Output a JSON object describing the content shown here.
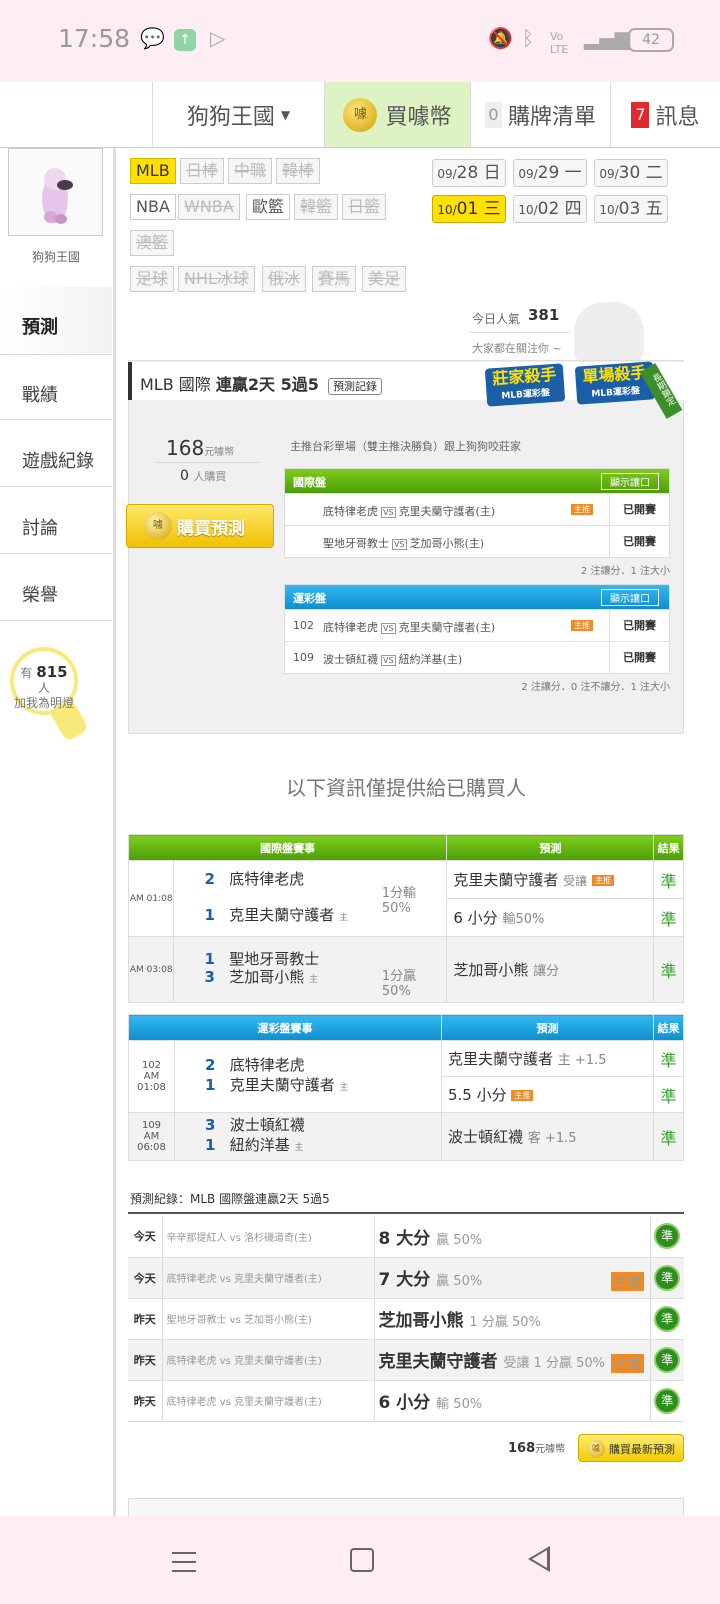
{
  "status": {
    "time": "17:58",
    "battery": "42"
  },
  "header": {
    "site": "狗狗王國",
    "buy_label": "買噱幣",
    "coin_glyph": "噱",
    "cart_count": "0",
    "cart_label": "購牌清單",
    "msg_count": "7",
    "msg_label": "訊息"
  },
  "sidebar": {
    "user_name": "狗狗王國",
    "items": [
      "預測",
      "戰績",
      "遊戲紀錄",
      "討論",
      "榮譽"
    ],
    "fans_prefix": "有",
    "fans_count": "815",
    "fans_unit": "人",
    "fans_sub": "加我為明燈"
  },
  "tags": [
    [
      "MLB",
      "sel"
    ],
    [
      "日棒",
      "off"
    ],
    [
      "中職",
      "off"
    ],
    [
      "韓棒",
      "off"
    ],
    [
      "NBA",
      "on"
    ],
    [
      "WNBA",
      "off"
    ],
    [
      "歐籃",
      "on"
    ],
    [
      "韓籃",
      "off"
    ],
    [
      "日籃",
      "off"
    ],
    [
      "澳籃",
      "off"
    ],
    [
      "足球",
      "off"
    ],
    [
      "NHL冰球",
      "off"
    ],
    [
      "俄冰",
      "off"
    ],
    [
      "賽馬",
      "off"
    ],
    [
      "美足",
      "off"
    ]
  ],
  "dates": [
    {
      "m": "09/",
      "d": "28",
      "w": "日"
    },
    {
      "m": "09/",
      "d": "29",
      "w": "一"
    },
    {
      "m": "09/",
      "d": "30",
      "w": "二"
    },
    {
      "m": "10/",
      "d": "01",
      "w": "三"
    },
    {
      "m": "10/",
      "d": "02",
      "w": "四"
    },
    {
      "m": "10/",
      "d": "03",
      "w": "五"
    }
  ],
  "popularity": {
    "label": "今日人氣",
    "value": "381",
    "sub": "大家都在關注你 ~"
  },
  "card": {
    "title_a": "MLB 國際",
    "title_b": "連贏2天 5過5",
    "rec_btn": "預測記錄",
    "badge1": "莊家殺手",
    "badge1_sub": "MLB運彩盤",
    "badge2": "單場殺手",
    "badge2_sub": "MLB運彩盤",
    "ribbon": "長期鎖定",
    "price": "168",
    "price_unit": "元噱幣",
    "buyers": "0",
    "buyers_unit": "人購買",
    "buy_btn": "購買預測",
    "desc": "主推台彩單場（雙主推決勝負）跟上狗狗咬莊家"
  },
  "intl_box": {
    "title": "國際盤",
    "btn": "顯示讓口",
    "rows": [
      {
        "num": "",
        "a": "底特律老虎",
        "b": "克里夫蘭守護者(主)",
        "host": "主推",
        "st": "已開賽"
      },
      {
        "num": "",
        "a": "聖地牙哥教士",
        "b": "芝加哥小熊(主)",
        "host": "",
        "st": "已開賽"
      }
    ],
    "note": "2 注讓分．1 注大小"
  },
  "lot_box": {
    "title": "運彩盤",
    "btn": "顯示讓口",
    "rows": [
      {
        "num": "102",
        "a": "底特律老虎",
        "b": "克里夫蘭守護者(主)",
        "host": "主推",
        "st": "已開賽"
      },
      {
        "num": "109",
        "a": "波士頓紅襪",
        "b": "紐約洋基(主)",
        "host": "",
        "st": "已開賽"
      }
    ],
    "note": "2 注讓分．0 注不讓分．1 注大小"
  },
  "info_notice": "以下資訊僅提供給已購買人",
  "intl_table": {
    "h1": "國際盤賽事",
    "h2": "預測",
    "h3": "結果",
    "t1": "AM 01:08",
    "t2": "AM 03:08",
    "s1": "2",
    "n1": "底特律老虎",
    "s2": "1",
    "n2": "克里夫蘭守護者",
    "line1a": "1分輸",
    "line1b": "50%",
    "p1": "克里夫蘭守護者",
    "p1s": "受讓",
    "p2": "6 小分",
    "p2s": "輸50%",
    "r": "準",
    "s3": "1",
    "n3": "聖地牙哥教士",
    "s4": "3",
    "n4": "芝加哥小熊",
    "line2a": "1分贏",
    "line2b": "50%",
    "p3": "芝加哥小熊",
    "p3s": "讓分",
    "host": "主推",
    "homemark": "主"
  },
  "lot_table": {
    "h1": "運彩盤賽事",
    "h2": "預測",
    "h3": "結果",
    "num1": "102",
    "t1": "AM 01:08",
    "num2": "109",
    "t2": "AM 06:08",
    "s1": "2",
    "n1": "底特律老虎",
    "s2": "1",
    "n2": "克里夫蘭守護者",
    "p1": "克里夫蘭守護者",
    "p1s": "主 +1.5",
    "p2": "5.5 小分",
    "s3": "3",
    "n3": "波士頓紅襪",
    "s4": "1",
    "n4": "紐約洋基",
    "p3": "波士頓紅襪",
    "p3s": "客 +1.5",
    "r": "準"
  },
  "records": {
    "title": "預測紀錄：MLB 國際盤連贏2天 5過5",
    "rows": [
      {
        "d": "今天",
        "m": "辛辛那提紅人 vs 洛杉磯道奇(主)",
        "p": "8 大分",
        "s": "贏 50%",
        "h": ""
      },
      {
        "d": "今天",
        "m": "底特律老虎 vs 克里夫蘭守護者(主)",
        "p": "7 大分",
        "s": "贏 50%",
        "h": "主推"
      },
      {
        "d": "昨天",
        "m": "聖地牙哥教士 vs 芝加哥小熊(主)",
        "p": "芝加哥小熊",
        "s": "1 分贏 50%",
        "h": ""
      },
      {
        "d": "昨天",
        "m": "底特律老虎 vs 克里夫蘭守護者(主)",
        "p": "克里夫蘭守護者",
        "s": "受讓 1 分贏 50%",
        "h": "主推"
      },
      {
        "d": "昨天",
        "m": "底特律老虎 vs 克里夫蘭守護者(主)",
        "p": "6 小分",
        "s": "輸 50%",
        "h": ""
      }
    ],
    "r": "準",
    "price": "168",
    "unit": "元噱幣",
    "buy": "購買最新預測"
  }
}
